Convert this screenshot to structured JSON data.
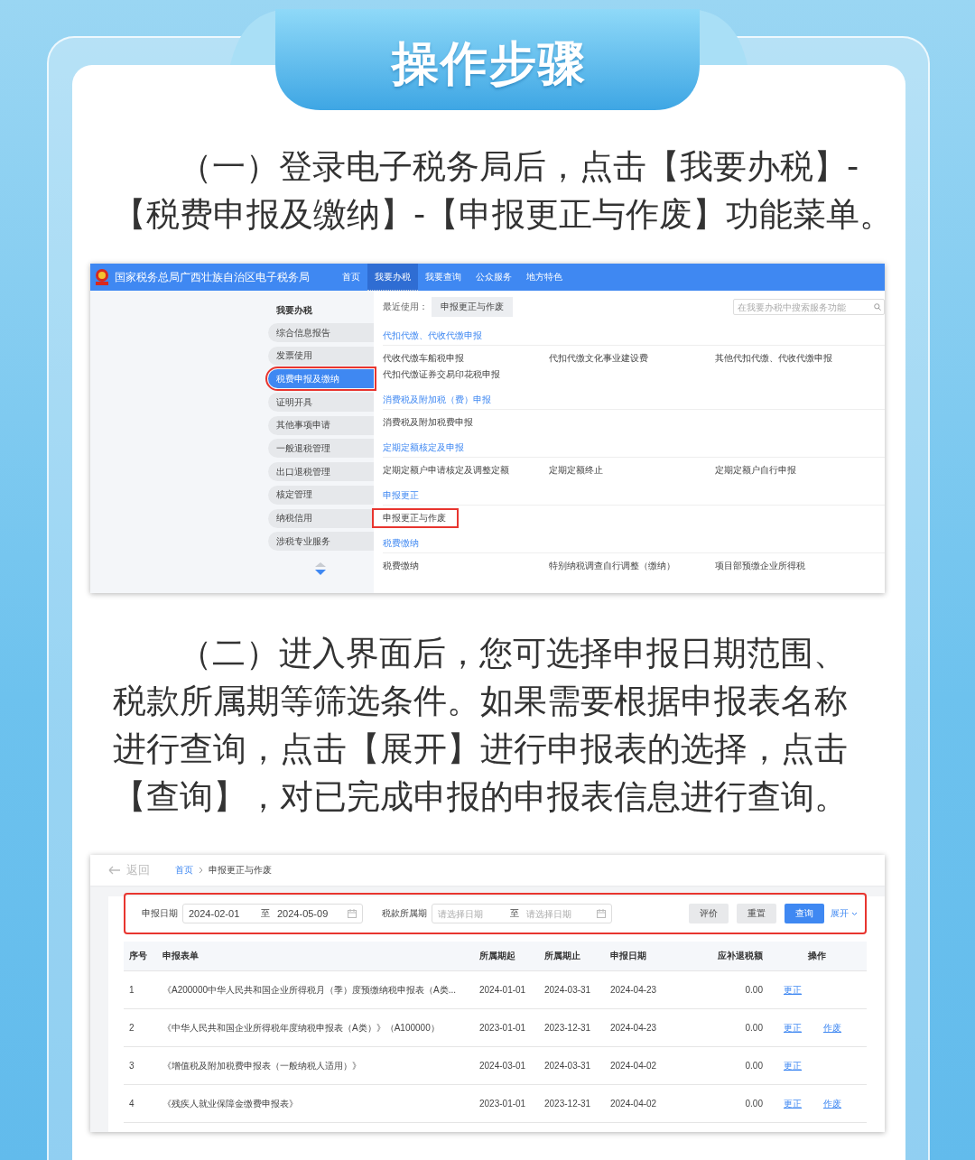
{
  "banner": {
    "title": "操作步骤"
  },
  "steps": [
    {
      "text": "（一）登录电子税务局后，点击【我要办税】-【税费申报及缴纳】-【申报更正与作废】功能菜单。",
      "portal": {
        "site_title": "国家税务总局广西壮族自治区电子税务局",
        "nav": [
          {
            "label": "首页",
            "selected": false
          },
          {
            "label": "我要办税",
            "selected": true
          },
          {
            "label": "我要查询",
            "selected": false
          },
          {
            "label": "公众服务",
            "selected": false
          },
          {
            "label": "地方特色",
            "selected": false
          }
        ],
        "sidebar": {
          "heading": "我要办税",
          "items": [
            {
              "label": "综合信息报告",
              "selected": false,
              "highlighted": false
            },
            {
              "label": "发票使用",
              "selected": false,
              "highlighted": false
            },
            {
              "label": "税费申报及缴纳",
              "selected": true,
              "highlighted": true
            },
            {
              "label": "证明开具",
              "selected": false,
              "highlighted": false
            },
            {
              "label": "其他事项申请",
              "selected": false,
              "highlighted": false
            },
            {
              "label": "一般退税管理",
              "selected": false,
              "highlighted": false
            },
            {
              "label": "出口退税管理",
              "selected": false,
              "highlighted": false
            },
            {
              "label": "核定管理",
              "selected": false,
              "highlighted": false
            },
            {
              "label": "纳税信用",
              "selected": false,
              "highlighted": false
            },
            {
              "label": "涉税专业服务",
              "selected": false,
              "highlighted": false
            }
          ]
        },
        "recent": {
          "label": "最近使用：",
          "items": [
            "申报更正与作废"
          ]
        },
        "search": {
          "placeholder": "在我要办税中搜索服务功能"
        },
        "groups": [
          {
            "title": "代扣代缴、代收代缴申报",
            "items": [
              {
                "label": "代收代缴车船税申报",
                "highlighted": false
              },
              {
                "label": "代扣代缴文化事业建设费",
                "highlighted": false
              },
              {
                "label": "其他代扣代缴、代收代缴申报",
                "highlighted": false
              },
              {
                "label": "代扣代缴证券交易印花税申报",
                "highlighted": false
              }
            ]
          },
          {
            "title": "消费税及附加税（费）申报",
            "items": [
              {
                "label": "消费税及附加税费申报",
                "highlighted": false
              }
            ]
          },
          {
            "title": "定期定额核定及申报",
            "items": [
              {
                "label": "定期定额户申请核定及调整定额",
                "highlighted": false
              },
              {
                "label": "定期定额终止",
                "highlighted": false
              },
              {
                "label": "定期定额户自行申报",
                "highlighted": false
              }
            ]
          },
          {
            "title": "申报更正",
            "items": [
              {
                "label": "申报更正与作废",
                "highlighted": true
              }
            ]
          },
          {
            "title": "税费缴纳",
            "items": [
              {
                "label": "税费缴纳",
                "highlighted": false
              },
              {
                "label": "特别纳税调查自行调整（缴纳）",
                "highlighted": false
              },
              {
                "label": "项目部预缴企业所得税",
                "highlighted": false
              }
            ]
          }
        ]
      }
    },
    {
      "text": "（二）进入界面后，您可选择申报日期范围、税款所属期等筛选条件。如果需要根据申报表名称进行查询，点击【展开】进行申报表的选择，点击【查询】，对已完成申报的申报表信息进行查询。",
      "query": {
        "back": "返回",
        "breadcrumb": [
          "首页",
          "申报更正与作废"
        ],
        "filters": {
          "highlighted": true,
          "date": {
            "label": "申报日期",
            "from": "2024-02-01",
            "separator": "至",
            "to": "2024-05-09"
          },
          "period": {
            "label": "税款所属期",
            "from_placeholder": "请选择日期",
            "separator": "至",
            "to_placeholder": "请选择日期"
          },
          "buttons": [
            {
              "label": "评价",
              "kind": "default"
            },
            {
              "label": "重置",
              "kind": "default"
            },
            {
              "label": "查询",
              "kind": "primary"
            }
          ],
          "expand": "展开"
        },
        "table": {
          "columns": [
            "序号",
            "申报表单",
            "所属期起",
            "所属期止",
            "申报日期",
            "应补退税额",
            "操作"
          ],
          "rows": [
            {
              "cells": [
                "1",
                "《A200000中华人民共和国企业所得税月（季）度预缴纳税申报表（A类...",
                "2024-01-01",
                "2024-03-31",
                "2024-04-23",
                "0.00"
              ],
              "actions": [
                "更正"
              ]
            },
            {
              "cells": [
                "2",
                "《中华人民共和国企业所得税年度纳税申报表（A类）》（A100000）",
                "2023-01-01",
                "2023-12-31",
                "2024-04-23",
                "0.00"
              ],
              "actions": [
                "更正",
                "作废"
              ]
            },
            {
              "cells": [
                "3",
                "《增值税及附加税费申报表（一般纳税人适用）》",
                "2024-03-01",
                "2024-03-31",
                "2024-04-02",
                "0.00"
              ],
              "actions": [
                "更正"
              ]
            },
            {
              "cells": [
                "4",
                "《残疾人就业保障金缴费申报表》",
                "2023-01-01",
                "2023-12-31",
                "2024-04-02",
                "0.00"
              ],
              "actions": [
                "更正",
                "作废"
              ]
            }
          ]
        }
      }
    }
  ]
}
